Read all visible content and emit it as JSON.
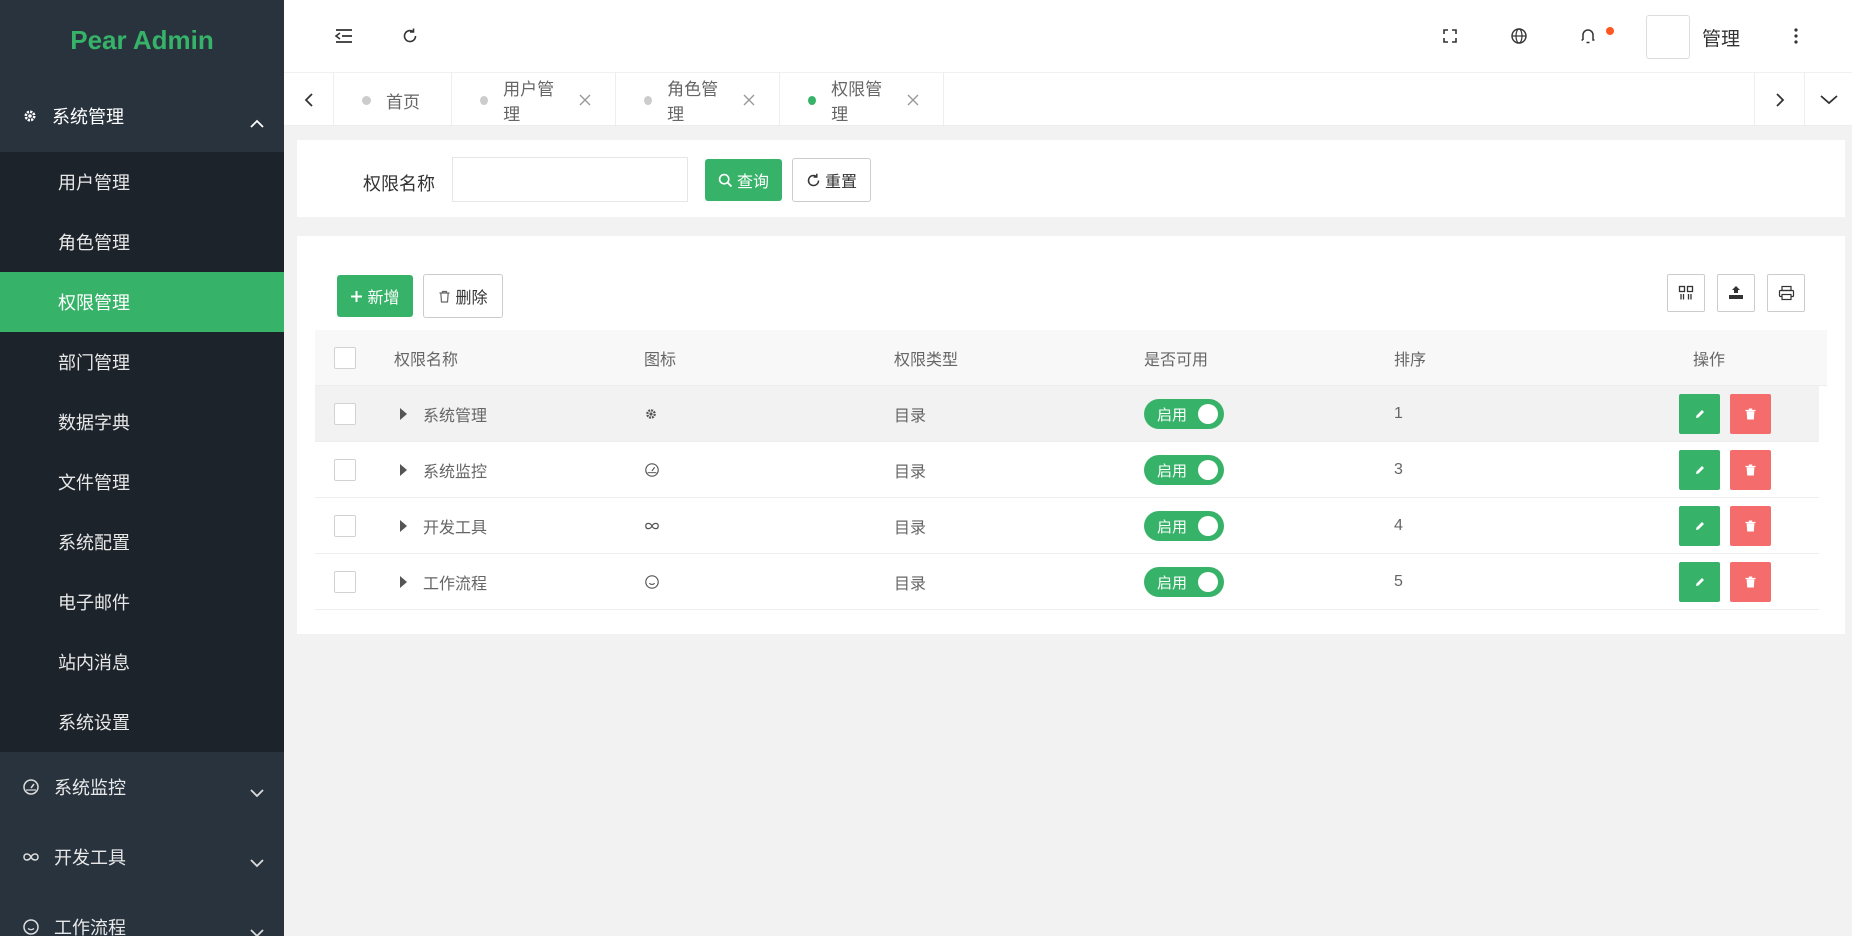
{
  "app": {
    "logo": "Pear Admin"
  },
  "sidebar": {
    "group_open": {
      "label": "系统管理",
      "icon": "gear-icon"
    },
    "items": [
      {
        "label": "用户管理"
      },
      {
        "label": "角色管理"
      },
      {
        "label": "权限管理",
        "active": true
      },
      {
        "label": "部门管理"
      },
      {
        "label": "数据字典"
      },
      {
        "label": "文件管理"
      },
      {
        "label": "系统配置"
      },
      {
        "label": "电子邮件"
      },
      {
        "label": "站内消息"
      },
      {
        "label": "系统设置"
      }
    ],
    "groups_collapsed": [
      {
        "label": "系统监控",
        "icon": "dashboard-icon"
      },
      {
        "label": "开发工具",
        "icon": "infinity-icon"
      },
      {
        "label": "工作流程",
        "icon": "smile-icon"
      }
    ]
  },
  "header": {
    "username": "管理",
    "notification_dot": true
  },
  "tabs": [
    {
      "label": "首页",
      "closable": false,
      "active": false
    },
    {
      "label": "用户管理",
      "closable": true,
      "active": false
    },
    {
      "label": "角色管理",
      "closable": true,
      "active": false
    },
    {
      "label": "权限管理",
      "closable": true,
      "active": true
    }
  ],
  "search": {
    "label": "权限名称",
    "value": "",
    "query_label": "查询",
    "reset_label": "重置"
  },
  "toolbar": {
    "add_label": "新增",
    "delete_label": "删除"
  },
  "table": {
    "columns": [
      "权限名称",
      "图标",
      "权限类型",
      "是否可用",
      "排序",
      "操作"
    ],
    "rows": [
      {
        "name": "系统管理",
        "icon": "gear-icon",
        "type": "目录",
        "enabled_label": "启用",
        "sort": "1"
      },
      {
        "name": "系统监控",
        "icon": "dashboard-icon",
        "type": "目录",
        "enabled_label": "启用",
        "sort": "3"
      },
      {
        "name": "开发工具",
        "icon": "infinity-icon",
        "type": "目录",
        "enabled_label": "启用",
        "sort": "4"
      },
      {
        "name": "工作流程",
        "icon": "smile-icon",
        "type": "目录",
        "enabled_label": "启用",
        "sort": "5"
      }
    ]
  },
  "colors": {
    "accent": "#36b368",
    "sidebar_bg": "#28333e",
    "submenu_bg": "#1c232b",
    "danger": "#f56c6c",
    "badge": "#ff5722"
  }
}
